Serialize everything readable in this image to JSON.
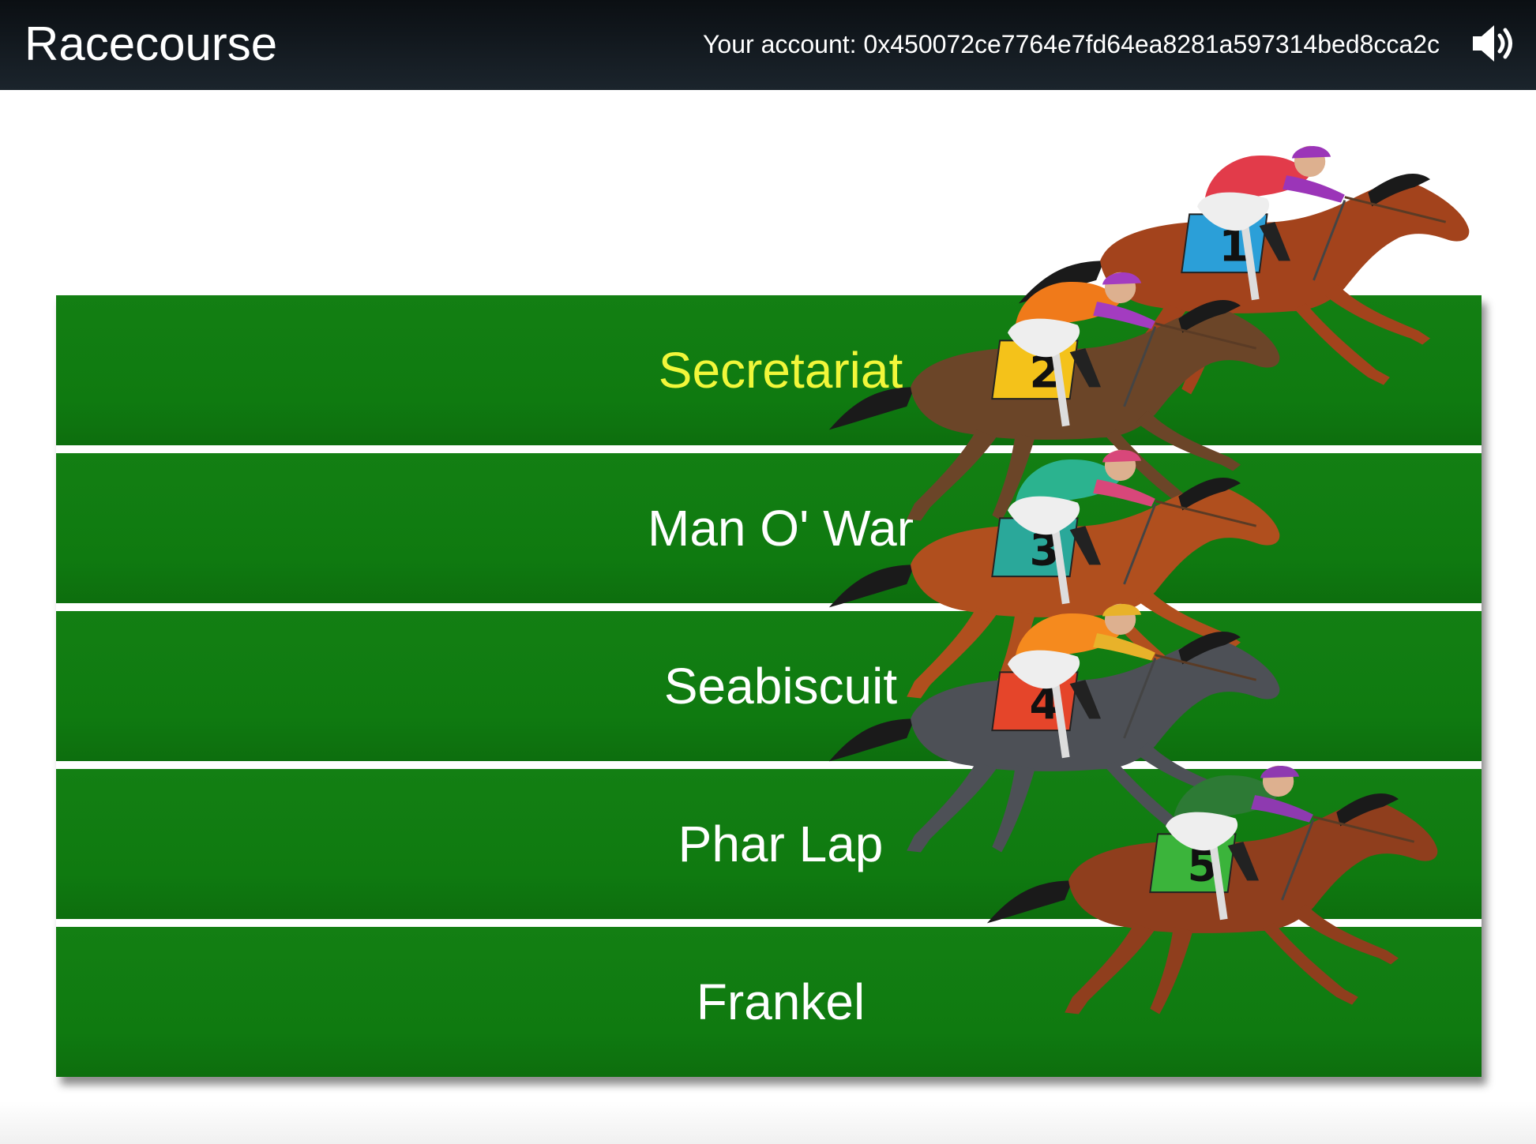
{
  "header": {
    "title": "Racecourse",
    "account_text": "Your account: 0x450072ce7764e7fd64ea8281a597314bed8cca2c",
    "sound_icon": "speaker-volume-icon"
  },
  "lanes": [
    {
      "label": "Secretariat",
      "selected": true
    },
    {
      "label": "Man O' War",
      "selected": false
    },
    {
      "label": "Seabiscuit",
      "selected": false
    },
    {
      "label": "Phar Lap",
      "selected": false
    },
    {
      "label": "Frankel",
      "selected": false
    }
  ],
  "horses": [
    {
      "number": "1",
      "coat": "#a3431c",
      "saddle": "#2b9fd8",
      "silks": "#e23b4a",
      "sleeves": "#9b35b8"
    },
    {
      "number": "2",
      "coat": "#6b4528",
      "saddle": "#f4c21a",
      "silks": "#f07a1a",
      "sleeves": "#a33cc0"
    },
    {
      "number": "3",
      "coat": "#b04f1e",
      "saddle": "#2aa89a",
      "silks": "#2bb38f",
      "sleeves": "#d8477a"
    },
    {
      "number": "4",
      "coat": "#4d5056",
      "saddle": "#e5452a",
      "silks": "#f58a1e",
      "sleeves": "#e8b22a"
    },
    {
      "number": "5",
      "coat": "#8f3e1d",
      "saddle": "#3bb43b",
      "silks": "#2d7a35",
      "sleeves": "#8e3ab0"
    }
  ],
  "colors": {
    "lane_green": "#107b10",
    "selected_text": "#f1f73a",
    "header_bg": "#111820"
  }
}
